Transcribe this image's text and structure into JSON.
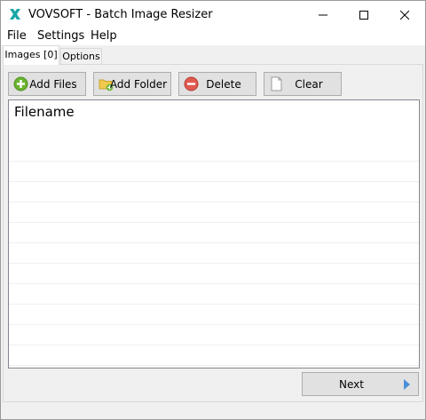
{
  "window": {
    "title": "VOVSOFT - Batch Image Resizer",
    "controls": [
      "minimize-icon",
      "maximize-icon",
      "close-icon"
    ]
  },
  "menu": {
    "items": [
      {
        "label": "File"
      },
      {
        "label": "Settings"
      },
      {
        "label": "Help"
      }
    ]
  },
  "tabs": {
    "items": [
      {
        "label": "Images [0]",
        "active": true
      },
      {
        "label": "Options",
        "active": false
      }
    ]
  },
  "toolbar": {
    "buttons": [
      {
        "label": "Add Files",
        "icon": "add-files-icon",
        "color": "#6ab42f"
      },
      {
        "label": "Add Folder",
        "icon": "add-folder-icon",
        "color": "#f2c94c"
      },
      {
        "label": "Delete",
        "icon": "delete-icon",
        "color": "#e05a4f"
      },
      {
        "label": "Clear",
        "icon": "clear-icon",
        "color": "#ffffff"
      }
    ]
  },
  "list": {
    "column_header": "Filename",
    "rows": []
  },
  "footer": {
    "next_label": "Next",
    "next_icon": "arrow-right-icon",
    "accent": "#4a90d9"
  }
}
